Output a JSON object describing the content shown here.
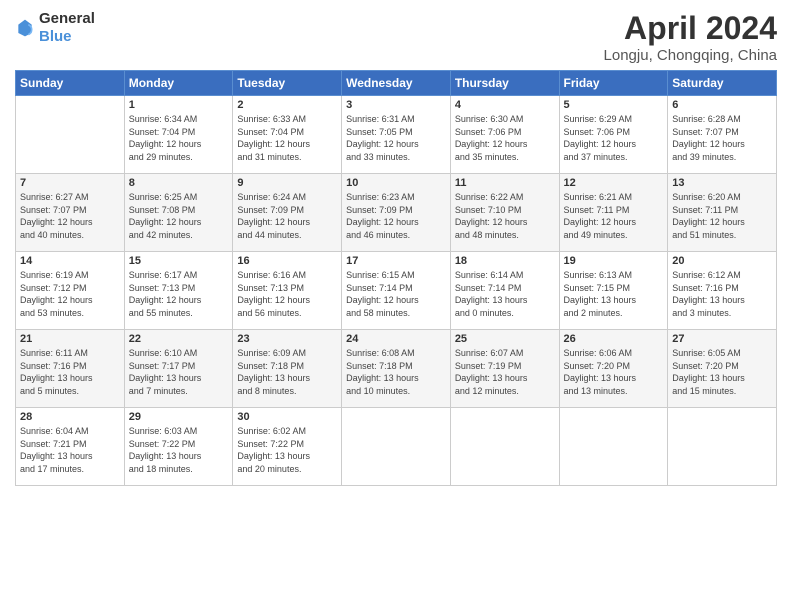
{
  "header": {
    "logo_general": "General",
    "logo_blue": "Blue",
    "title": "April 2024",
    "location": "Longju, Chongqing, China"
  },
  "weekdays": [
    "Sunday",
    "Monday",
    "Tuesday",
    "Wednesday",
    "Thursday",
    "Friday",
    "Saturday"
  ],
  "weeks": [
    [
      {
        "day": "",
        "info": ""
      },
      {
        "day": "1",
        "info": "Sunrise: 6:34 AM\nSunset: 7:04 PM\nDaylight: 12 hours\nand 29 minutes."
      },
      {
        "day": "2",
        "info": "Sunrise: 6:33 AM\nSunset: 7:04 PM\nDaylight: 12 hours\nand 31 minutes."
      },
      {
        "day": "3",
        "info": "Sunrise: 6:31 AM\nSunset: 7:05 PM\nDaylight: 12 hours\nand 33 minutes."
      },
      {
        "day": "4",
        "info": "Sunrise: 6:30 AM\nSunset: 7:06 PM\nDaylight: 12 hours\nand 35 minutes."
      },
      {
        "day": "5",
        "info": "Sunrise: 6:29 AM\nSunset: 7:06 PM\nDaylight: 12 hours\nand 37 minutes."
      },
      {
        "day": "6",
        "info": "Sunrise: 6:28 AM\nSunset: 7:07 PM\nDaylight: 12 hours\nand 39 minutes."
      }
    ],
    [
      {
        "day": "7",
        "info": "Sunrise: 6:27 AM\nSunset: 7:07 PM\nDaylight: 12 hours\nand 40 minutes."
      },
      {
        "day": "8",
        "info": "Sunrise: 6:25 AM\nSunset: 7:08 PM\nDaylight: 12 hours\nand 42 minutes."
      },
      {
        "day": "9",
        "info": "Sunrise: 6:24 AM\nSunset: 7:09 PM\nDaylight: 12 hours\nand 44 minutes."
      },
      {
        "day": "10",
        "info": "Sunrise: 6:23 AM\nSunset: 7:09 PM\nDaylight: 12 hours\nand 46 minutes."
      },
      {
        "day": "11",
        "info": "Sunrise: 6:22 AM\nSunset: 7:10 PM\nDaylight: 12 hours\nand 48 minutes."
      },
      {
        "day": "12",
        "info": "Sunrise: 6:21 AM\nSunset: 7:11 PM\nDaylight: 12 hours\nand 49 minutes."
      },
      {
        "day": "13",
        "info": "Sunrise: 6:20 AM\nSunset: 7:11 PM\nDaylight: 12 hours\nand 51 minutes."
      }
    ],
    [
      {
        "day": "14",
        "info": "Sunrise: 6:19 AM\nSunset: 7:12 PM\nDaylight: 12 hours\nand 53 minutes."
      },
      {
        "day": "15",
        "info": "Sunrise: 6:17 AM\nSunset: 7:13 PM\nDaylight: 12 hours\nand 55 minutes."
      },
      {
        "day": "16",
        "info": "Sunrise: 6:16 AM\nSunset: 7:13 PM\nDaylight: 12 hours\nand 56 minutes."
      },
      {
        "day": "17",
        "info": "Sunrise: 6:15 AM\nSunset: 7:14 PM\nDaylight: 12 hours\nand 58 minutes."
      },
      {
        "day": "18",
        "info": "Sunrise: 6:14 AM\nSunset: 7:14 PM\nDaylight: 13 hours\nand 0 minutes."
      },
      {
        "day": "19",
        "info": "Sunrise: 6:13 AM\nSunset: 7:15 PM\nDaylight: 13 hours\nand 2 minutes."
      },
      {
        "day": "20",
        "info": "Sunrise: 6:12 AM\nSunset: 7:16 PM\nDaylight: 13 hours\nand 3 minutes."
      }
    ],
    [
      {
        "day": "21",
        "info": "Sunrise: 6:11 AM\nSunset: 7:16 PM\nDaylight: 13 hours\nand 5 minutes."
      },
      {
        "day": "22",
        "info": "Sunrise: 6:10 AM\nSunset: 7:17 PM\nDaylight: 13 hours\nand 7 minutes."
      },
      {
        "day": "23",
        "info": "Sunrise: 6:09 AM\nSunset: 7:18 PM\nDaylight: 13 hours\nand 8 minutes."
      },
      {
        "day": "24",
        "info": "Sunrise: 6:08 AM\nSunset: 7:18 PM\nDaylight: 13 hours\nand 10 minutes."
      },
      {
        "day": "25",
        "info": "Sunrise: 6:07 AM\nSunset: 7:19 PM\nDaylight: 13 hours\nand 12 minutes."
      },
      {
        "day": "26",
        "info": "Sunrise: 6:06 AM\nSunset: 7:20 PM\nDaylight: 13 hours\nand 13 minutes."
      },
      {
        "day": "27",
        "info": "Sunrise: 6:05 AM\nSunset: 7:20 PM\nDaylight: 13 hours\nand 15 minutes."
      }
    ],
    [
      {
        "day": "28",
        "info": "Sunrise: 6:04 AM\nSunset: 7:21 PM\nDaylight: 13 hours\nand 17 minutes."
      },
      {
        "day": "29",
        "info": "Sunrise: 6:03 AM\nSunset: 7:22 PM\nDaylight: 13 hours\nand 18 minutes."
      },
      {
        "day": "30",
        "info": "Sunrise: 6:02 AM\nSunset: 7:22 PM\nDaylight: 13 hours\nand 20 minutes."
      },
      {
        "day": "",
        "info": ""
      },
      {
        "day": "",
        "info": ""
      },
      {
        "day": "",
        "info": ""
      },
      {
        "day": "",
        "info": ""
      }
    ]
  ]
}
